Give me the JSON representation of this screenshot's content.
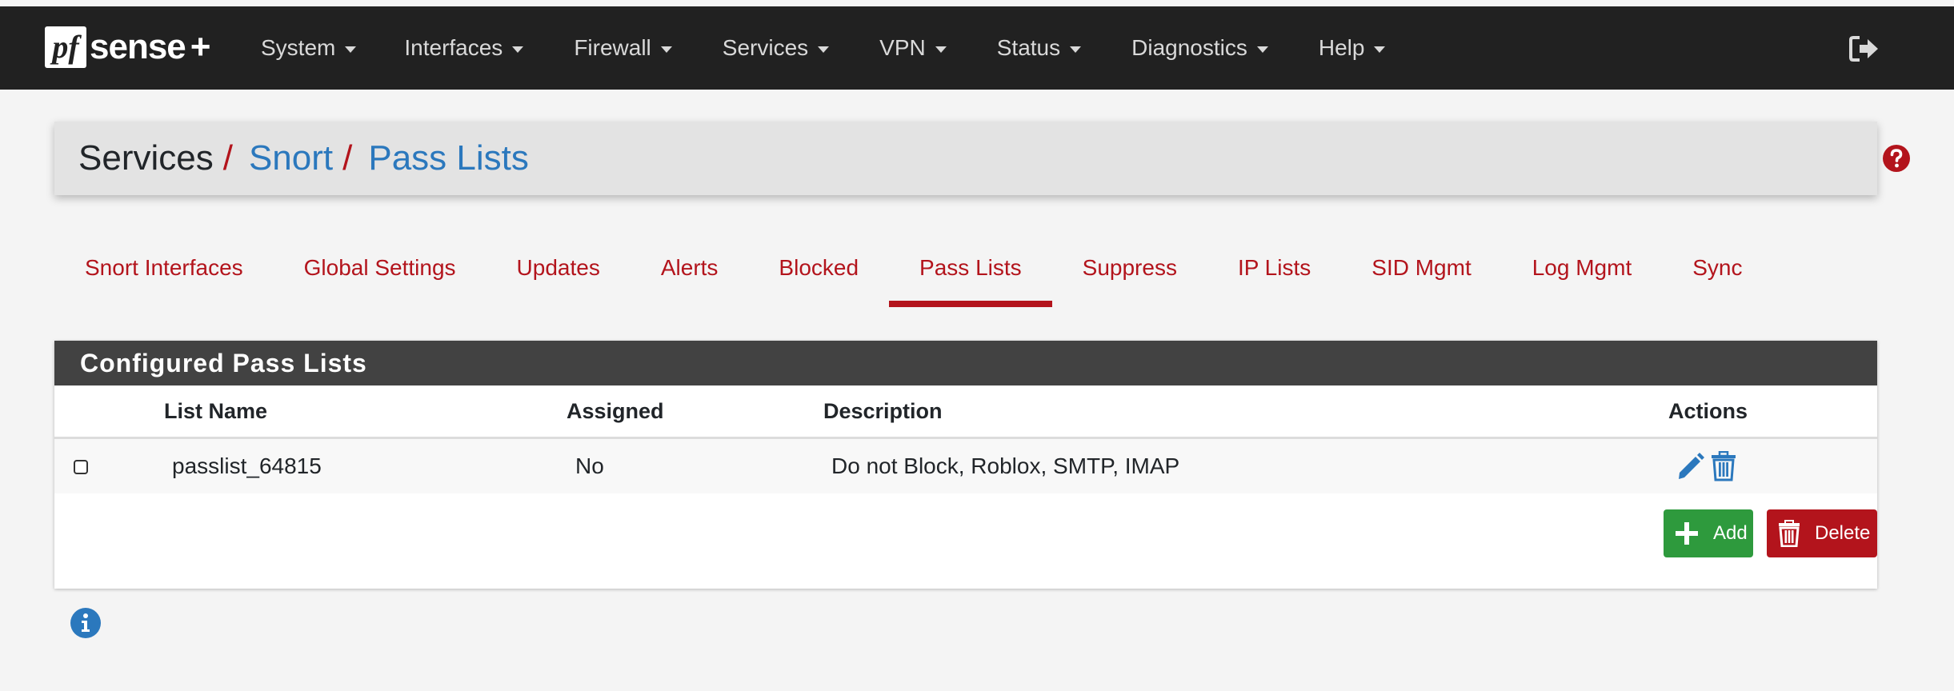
{
  "navbar": {
    "logo": {
      "pf": "pf",
      "sense": "sense",
      "plus": "+"
    },
    "items": [
      {
        "label": "System"
      },
      {
        "label": "Interfaces"
      },
      {
        "label": "Firewall"
      },
      {
        "label": "Services"
      },
      {
        "label": "VPN"
      },
      {
        "label": "Status"
      },
      {
        "label": "Diagnostics"
      },
      {
        "label": "Help"
      }
    ],
    "logout_icon": "sign-out-icon"
  },
  "breadcrumb": {
    "root": "Services",
    "separator": "/",
    "level1": "Snort",
    "level2": "Pass Lists",
    "help_icon": "question-circle-icon"
  },
  "tabs": [
    {
      "label": "Snort Interfaces"
    },
    {
      "label": "Global Settings"
    },
    {
      "label": "Updates"
    },
    {
      "label": "Alerts"
    },
    {
      "label": "Blocked"
    },
    {
      "label": "Pass Lists",
      "active": true
    },
    {
      "label": "Suppress"
    },
    {
      "label": "IP Lists"
    },
    {
      "label": "SID Mgmt"
    },
    {
      "label": "Log Mgmt"
    },
    {
      "label": "Sync"
    }
  ],
  "panel": {
    "title": "Configured Pass Lists",
    "columns": {
      "name": "List Name",
      "assigned": "Assigned",
      "description": "Description",
      "actions": "Actions"
    },
    "rows": [
      {
        "name": "passlist_64815",
        "assigned": "No",
        "description": "Do not Block, Roblox, SMTP, IMAP"
      }
    ],
    "add_label": "Add",
    "delete_label": "Delete"
  },
  "colors": {
    "navbar": "#212121",
    "accent_red": "#b3141c",
    "link_blue": "#2b78bd",
    "add_green": "#2e9a3d",
    "panel_header": "#424242"
  }
}
